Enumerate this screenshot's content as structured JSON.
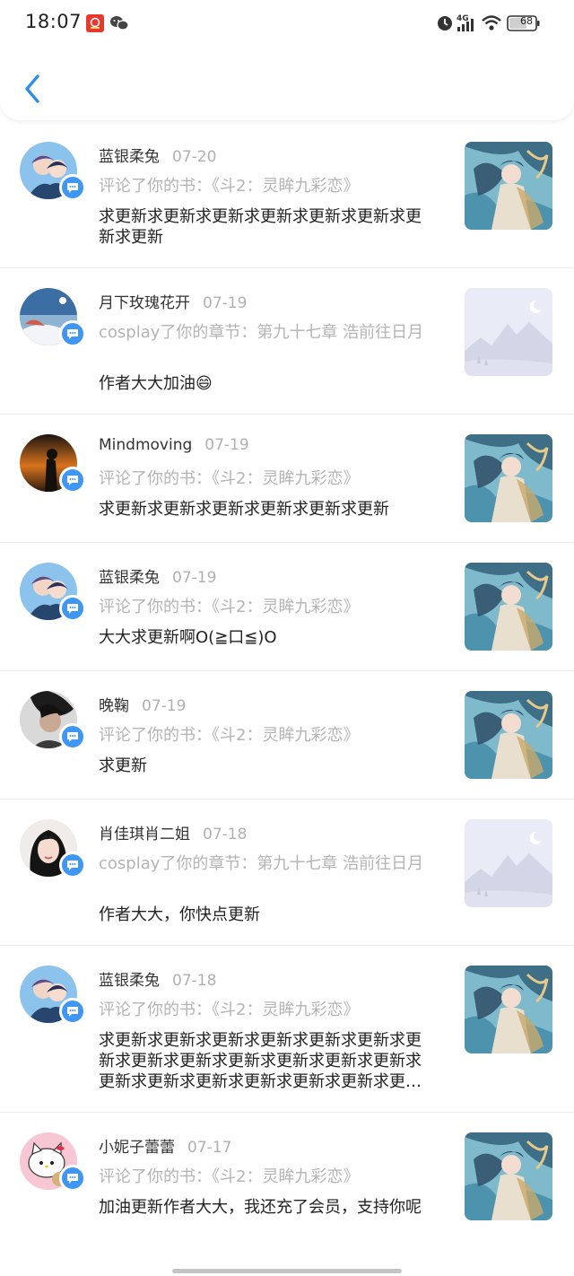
{
  "status_bar": {
    "time": "18:07",
    "network": "4G",
    "battery": "68"
  },
  "colors": {
    "accent": "#2f8ee6",
    "badge": "#3e96f5",
    "muted": "#b4b4b4"
  },
  "notifications": [
    {
      "name": "蓝银柔兔",
      "date": "07-20",
      "action": "评论了你的书：《斗2：灵眸九彩恋》",
      "content": "求更新求更新求更新求更新求更新求更新求更新求更新",
      "avatar_icon": "avatar-couple-icon",
      "thumb_icon": "book-cover-icon"
    },
    {
      "name": "月下玫瑰花开",
      "date": "07-19",
      "action": "cosplay了你的章节：第九十七章 浩前往日月",
      "content": "作者大大加油😄",
      "avatar_icon": "avatar-sky-icon",
      "thumb_icon": "placeholder-cover-icon"
    },
    {
      "name": "Mindmoving",
      "date": "07-19",
      "action": "评论了你的书：《斗2：灵眸九彩恋》",
      "content": "求更新求更新求更新求更新求更新求更新",
      "avatar_icon": "avatar-sunset-icon",
      "thumb_icon": "book-cover-icon"
    },
    {
      "name": "蓝银柔兔",
      "date": "07-19",
      "action": "评论了你的书：《斗2：灵眸九彩恋》",
      "content": "大大求更新啊O(≧口≦)O",
      "avatar_icon": "avatar-couple-icon",
      "thumb_icon": "book-cover-icon"
    },
    {
      "name": "晚鞠",
      "date": "07-19",
      "action": "评论了你的书：《斗2：灵眸九彩恋》",
      "content": "求更新",
      "avatar_icon": "avatar-person-icon",
      "thumb_icon": "book-cover-icon"
    },
    {
      "name": "肖佳琪肖二姐",
      "date": "07-18",
      "action": "cosplay了你的章节：第九十七章 浩前往日月",
      "content": "作者大大，你快点更新",
      "avatar_icon": "avatar-girl-icon",
      "thumb_icon": "placeholder-cover-icon"
    },
    {
      "name": "蓝银柔兔",
      "date": "07-18",
      "action": "评论了你的书：《斗2：灵眸九彩恋》",
      "content": "求更新求更新求更新求更新求更新求更新求更新求更新求更新求更新求更新求更新求更新求更新求更新求更新求更新求更新求更新求更新求更新求更新求更新求更…",
      "avatar_icon": "avatar-couple-icon",
      "thumb_icon": "book-cover-icon"
    },
    {
      "name": "小妮子蕾蕾",
      "date": "07-17",
      "action": "评论了你的书：《斗2：灵眸九彩恋》",
      "content": "加油更新作者大大，我还充了会员，支持你呢",
      "avatar_icon": "avatar-kitty-icon",
      "thumb_icon": "book-cover-icon"
    }
  ]
}
